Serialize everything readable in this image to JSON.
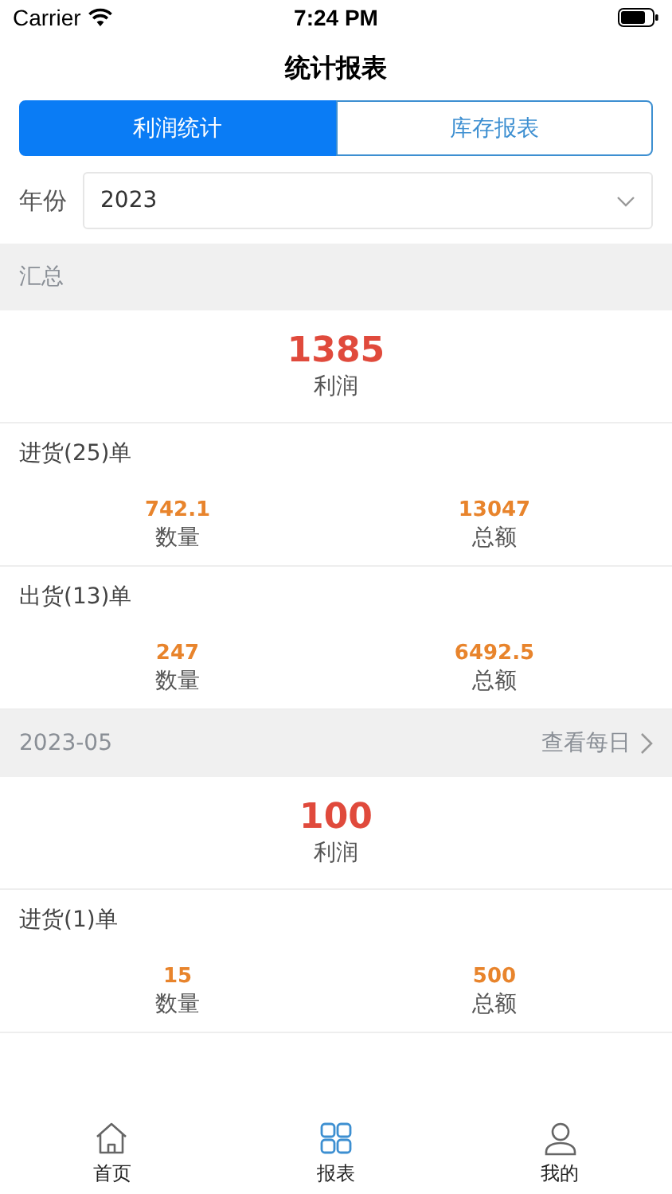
{
  "status_bar": {
    "carrier": "Carrier",
    "time": "7:24 PM"
  },
  "title": "统计报表",
  "tabs": [
    {
      "label": "利润统计",
      "selected": true
    },
    {
      "label": "库存报表",
      "selected": false
    }
  ],
  "year_filter": {
    "label": "年份",
    "value": "2023"
  },
  "sections": [
    {
      "title": "汇总",
      "profit": {
        "value": "1385",
        "label": "利润"
      },
      "groups": [
        {
          "title": "进货(25)单",
          "stats": [
            {
              "value": "742.1",
              "label": "数量"
            },
            {
              "value": "13047",
              "label": "总额"
            }
          ]
        },
        {
          "title": "出货(13)单",
          "stats": [
            {
              "value": "247",
              "label": "数量"
            },
            {
              "value": "6492.5",
              "label": "总额"
            }
          ]
        }
      ]
    },
    {
      "title": "2023-05",
      "link": "查看每日",
      "profit": {
        "value": "100",
        "label": "利润"
      },
      "groups": [
        {
          "title": "进货(1)单",
          "stats": [
            {
              "value": "15",
              "label": "数量"
            },
            {
              "value": "500",
              "label": "总额"
            }
          ]
        }
      ]
    }
  ],
  "tab_bar": [
    {
      "label": "首页",
      "kind": "home",
      "selected": false
    },
    {
      "label": "报表",
      "kind": "grid",
      "selected": true
    },
    {
      "label": "我的",
      "kind": "person",
      "selected": false
    }
  ]
}
